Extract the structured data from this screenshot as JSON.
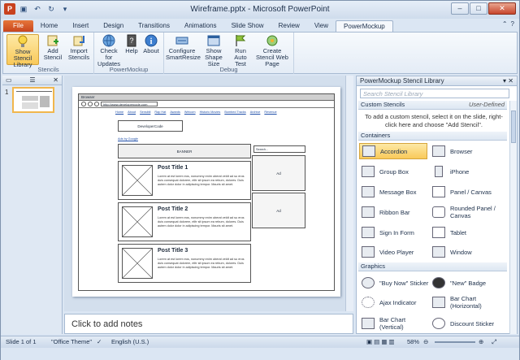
{
  "window": {
    "title": "Wireframe.pptx - Microsoft PowerPoint"
  },
  "tabs": [
    "File",
    "Home",
    "Insert",
    "Design",
    "Transitions",
    "Animations",
    "Slide Show",
    "Review",
    "View",
    "PowerMockup"
  ],
  "ribbon": {
    "groups": [
      {
        "label": "Stencils",
        "buttons": [
          "Show Stencil Library",
          "Add Stencil",
          "Import Stencils"
        ]
      },
      {
        "label": "PowerMockup",
        "buttons": [
          "Check for Updates",
          "Help",
          "About"
        ]
      },
      {
        "label": "Debug",
        "buttons": [
          "Configure SmartResize",
          "Show Shape Size",
          "Run Auto Test",
          "Create Stencil Web Page"
        ]
      }
    ]
  },
  "thumbs": {
    "slide_number": "1"
  },
  "wireframe": {
    "browser_title": "Browser",
    "url": "http://www.developercode.com",
    "nav": [
      "Home",
      "About",
      "Sensibil",
      "Rap Hat",
      "Awards",
      "Welcom",
      "Historic Movies",
      "Bombed Tracks",
      "Archive",
      "Revenue"
    ],
    "logo": "DeveloperCode",
    "link": "Ads by Google",
    "banner": "BANNER",
    "search": "Search...",
    "ad": "Ad",
    "posts": [
      {
        "title": "Post Title 1",
        "body": "Lorem at est lorem eos, nonummy enim uberat veldt ad su eros duis consequat dolorem, elitr sit ipsum ea rebum, dolores. Duis autem dolor dolor in adipiscing tempor. Mauris sit amet."
      },
      {
        "title": "Post Title 2",
        "body": "Lorem at est lorem eos, nonummy enim uberat veldt ad su eros duis consequat dolorem, elitr sit ipsum ea rebum, dolores. Duis autem dolor dolor in adipiscing tempor. Mauris sit amet."
      },
      {
        "title": "Post Title 3",
        "body": "Lorem at est lorem eos, nonummy enim uberat veldt ad su eros duis consequat dolorem, elitr sit ipsum ea rebum, dolores. Duis autem dolor dolor in adipiscing tempor. Mauris sit amet."
      }
    ]
  },
  "notes": {
    "placeholder": "Click to add notes"
  },
  "library": {
    "title": "PowerMockup Stencil Library",
    "search_placeholder": "Search Stencil Library",
    "custom_section": "Custom Stencils",
    "custom_filter": "User-Defined",
    "custom_message": "To add a custom stencil, select it on the slide, right-click here and choose \"Add Stencil\".",
    "containers_section": "Containers",
    "containers": [
      "Accordion",
      "Browser",
      "Group Box",
      "iPhone",
      "Message Box",
      "Panel / Canvas",
      "Ribbon Bar",
      "Rounded Panel / Canvas",
      "Sign In Form",
      "Tablet",
      "Video Player",
      "Window"
    ],
    "graphics_section": "Graphics",
    "graphics": [
      "\"Buy Now\" Sticker",
      "\"New\" Badge",
      "Ajax Indicator",
      "Bar Chart (Horizontal)",
      "Bar Chart (Vertical)",
      "Discount Sticker"
    ]
  },
  "status": {
    "slide": "Slide 1 of 1",
    "theme": "\"Office Theme\"",
    "language": "English (U.S.)",
    "zoom": "58%"
  },
  "colors": {
    "accent": "#f9c95a",
    "file_tab": "#c8461e",
    "chrome": "#dbe6f3"
  }
}
